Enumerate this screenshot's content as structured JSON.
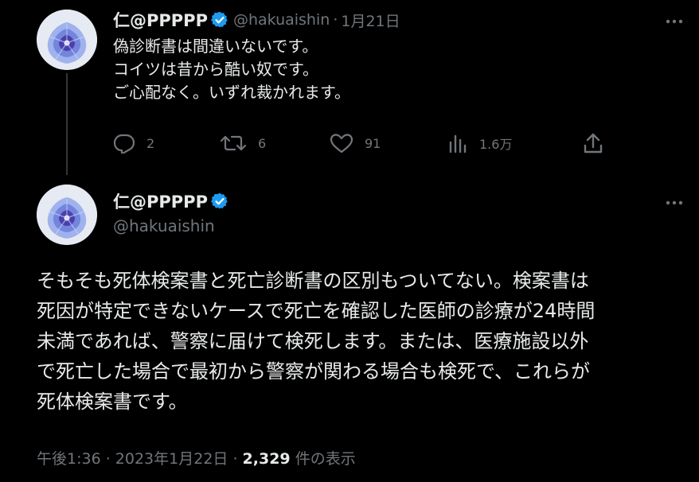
{
  "colors": {
    "background": "#000000",
    "text_primary": "#e7e9ea",
    "text_secondary": "#71767b",
    "verified_blue": "#1d9bf0",
    "thread_line": "#333639"
  },
  "tweet1": {
    "display_name": "仁@PPPPP",
    "handle": "@hakuaishin",
    "separator": "·",
    "date": "1月21日",
    "lines": [
      "偽診断書は間違いないです。",
      "コイツは昔から酷い奴です。",
      "ご心配なく。いずれ裁かれます。"
    ],
    "actions": {
      "reply_count": "2",
      "retweet_count": "6",
      "like_count": "91",
      "views_count": "1.6万"
    },
    "icons": [
      "reply-icon",
      "retweet-icon",
      "like-icon",
      "views-icon",
      "share-icon",
      "more-icon"
    ]
  },
  "tweet2": {
    "display_name": "仁@PPPPP",
    "handle": "@hakuaishin",
    "lines": [
      "そもそも死体検案書と死亡診断書の区別もついてない。検案書は",
      "死因が特定できないケースで死亡を確認した医師の診療が24時間",
      "未満であれば、警察に届けて検死します。または、医療施設以外",
      "で死亡した場合で最初から警察が関わる場合も検死で、これらが",
      "死体検案書です。"
    ],
    "meta": {
      "time": "午後1:36",
      "separator": " · ",
      "date": "2023年1月22日",
      "views_count": "2,329",
      "views_label": "件の表示"
    }
  }
}
